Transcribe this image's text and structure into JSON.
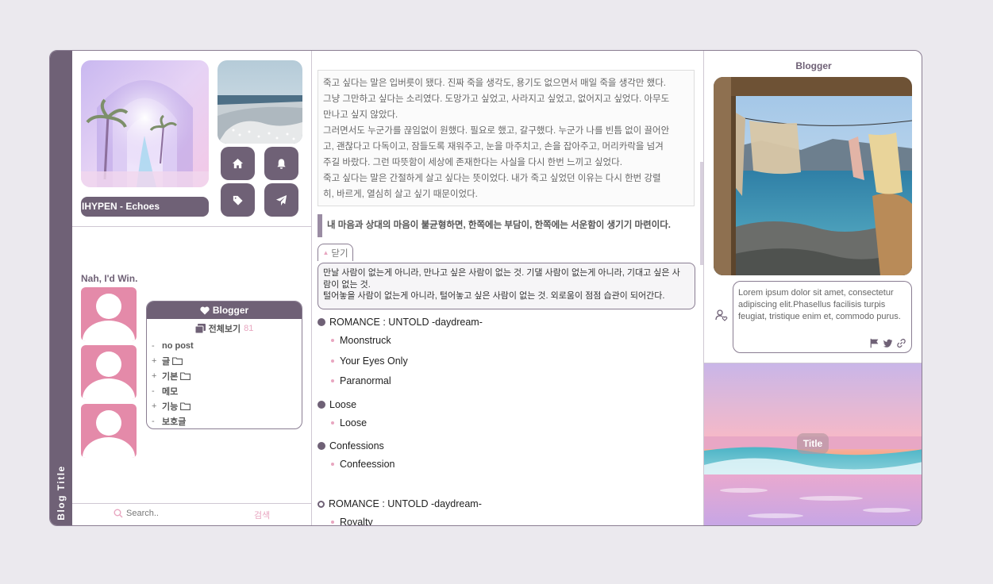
{
  "sidebar": {
    "blog_title": "Blog Title"
  },
  "music": {
    "now_playing": "IHYPEN - Echoes"
  },
  "nav_buttons": [
    {
      "icon": "home-icon"
    },
    {
      "icon": "bell-icon"
    },
    {
      "icon": "tag-icon"
    },
    {
      "icon": "send-icon"
    }
  ],
  "profile": {
    "nickname": "Nah, I'd Win."
  },
  "category": {
    "header": "Blogger",
    "all_label": "전체보기",
    "all_count": "81",
    "items": [
      {
        "mark": "-",
        "label": "no post",
        "folder": false
      },
      {
        "mark": "+",
        "label": "글",
        "folder": true
      },
      {
        "mark": "+",
        "label": "기본",
        "folder": true
      },
      {
        "mark": "-",
        "label": "메모",
        "folder": false
      },
      {
        "mark": "+",
        "label": "기능",
        "folder": true
      },
      {
        "mark": "-",
        "label": "보호글",
        "folder": false
      }
    ]
  },
  "search": {
    "placeholder": "Search..",
    "button": "검색"
  },
  "post": {
    "quote_lines": [
      "죽고 싶다는 말은 입버릇이 됐다. 진짜 죽을 생각도, 용기도 없으면서 매일 죽을 생각만 했다.",
      "그냥 그만하고 싶다는 소리였다. 도망가고 싶었고, 사라지고 싶었고, 없어지고 싶었다. 아무도",
      "만나고 싶지 않았다.",
      "그러면서도 누군가를 끊임없이 원했다. 필요로 했고, 갈구했다. 누군가 나를 빈틈 없이 끌어안",
      "고, 괜찮다고 다독이고, 잠들도록 재워주고, 눈을 마주치고, 손을 잡아주고, 머리카락을 넘겨",
      "주길 바랐다. 그런 따뜻함이 세상에 존재한다는 사실을 다시 한번 느끼고 싶었다.",
      "죽고 싶다는 말은 간절하게 살고 싶다는 뜻이었다. 내가 죽고 싶었던 이유는 다시 한번 강렬",
      "히, 바르게, 열심히 살고 싶기 때문이었다."
    ],
    "callout": "내 마음과 상대의 마음이 불균형하면, 한쪽에는 부담이, 한쪽에는 서운함이 생기기 마련이다.",
    "close_label": "닫기",
    "fold_lines": [
      "만날 사람이 없는게 아니라, 만나고 싶은 사람이 없는 것. 기댈 사람이 없는게 아니라, 기대고 싶은 사",
      "람이 없는 것.",
      "털어놓을 사람이 없는게 아니라, 털어놓고 싶은 사람이 없는 것. 외로움이 점점 습관이 되어간다."
    ],
    "series": [
      {
        "title": "ROMANCE : UNTOLD -daydream-",
        "items": [
          "Moonstruck",
          "Your Eyes Only",
          "Paranormal"
        ]
      },
      {
        "title": "Loose",
        "items": [
          "Loose"
        ]
      },
      {
        "title": "Confessions",
        "items": [
          "Confeession"
        ]
      },
      {
        "title": "ROMANCE : UNTOLD -daydream-",
        "items": [
          "Royalty"
        ]
      }
    ]
  },
  "right": {
    "blogger_label": "Blogger",
    "bio": "Lorem ipsum dolor sit amet, consectetur adipiscing elit.Phasellus facilisis turpis feugiat, tristique enim et, commodo purus.",
    "bio_icons": [
      "flag-icon",
      "twitter-icon",
      "link-icon"
    ],
    "banner_title": "Title"
  },
  "colors": {
    "accent": "#6f6176",
    "pink": "#e48aa9",
    "light_pink": "#e8a6c0",
    "border": "#8a7d92"
  }
}
